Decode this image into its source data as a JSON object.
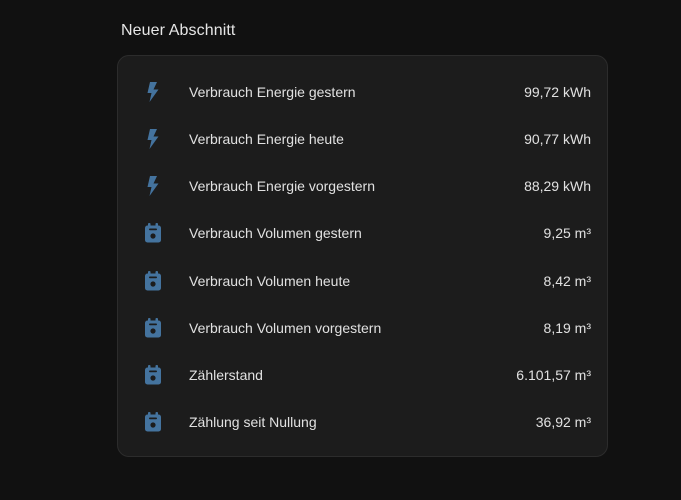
{
  "section": {
    "title": "Neuer Abschnitt"
  },
  "colors": {
    "icon": "#44739e",
    "background": "#111111",
    "card": "#1c1c1c",
    "text": "#e1e1e1"
  },
  "entities": [
    {
      "icon": "flash-icon",
      "name": "Verbrauch Energie gestern",
      "value": "99,72 kWh"
    },
    {
      "icon": "flash-icon",
      "name": "Verbrauch Energie heute",
      "value": "90,77 kWh"
    },
    {
      "icon": "flash-icon",
      "name": "Verbrauch Energie vorgestern",
      "value": "88,29 kWh"
    },
    {
      "icon": "meter-icon",
      "name": "Verbrauch Volumen gestern",
      "value": "9,25 m³"
    },
    {
      "icon": "meter-icon",
      "name": "Verbrauch Volumen heute",
      "value": "8,42 m³"
    },
    {
      "icon": "meter-icon",
      "name": "Verbrauch Volumen vorgestern",
      "value": "8,19 m³"
    },
    {
      "icon": "meter-icon",
      "name": "Zählerstand",
      "value": "6.101,57 m³"
    },
    {
      "icon": "meter-icon",
      "name": "Zählung seit Nullung",
      "value": "36,92 m³"
    }
  ]
}
